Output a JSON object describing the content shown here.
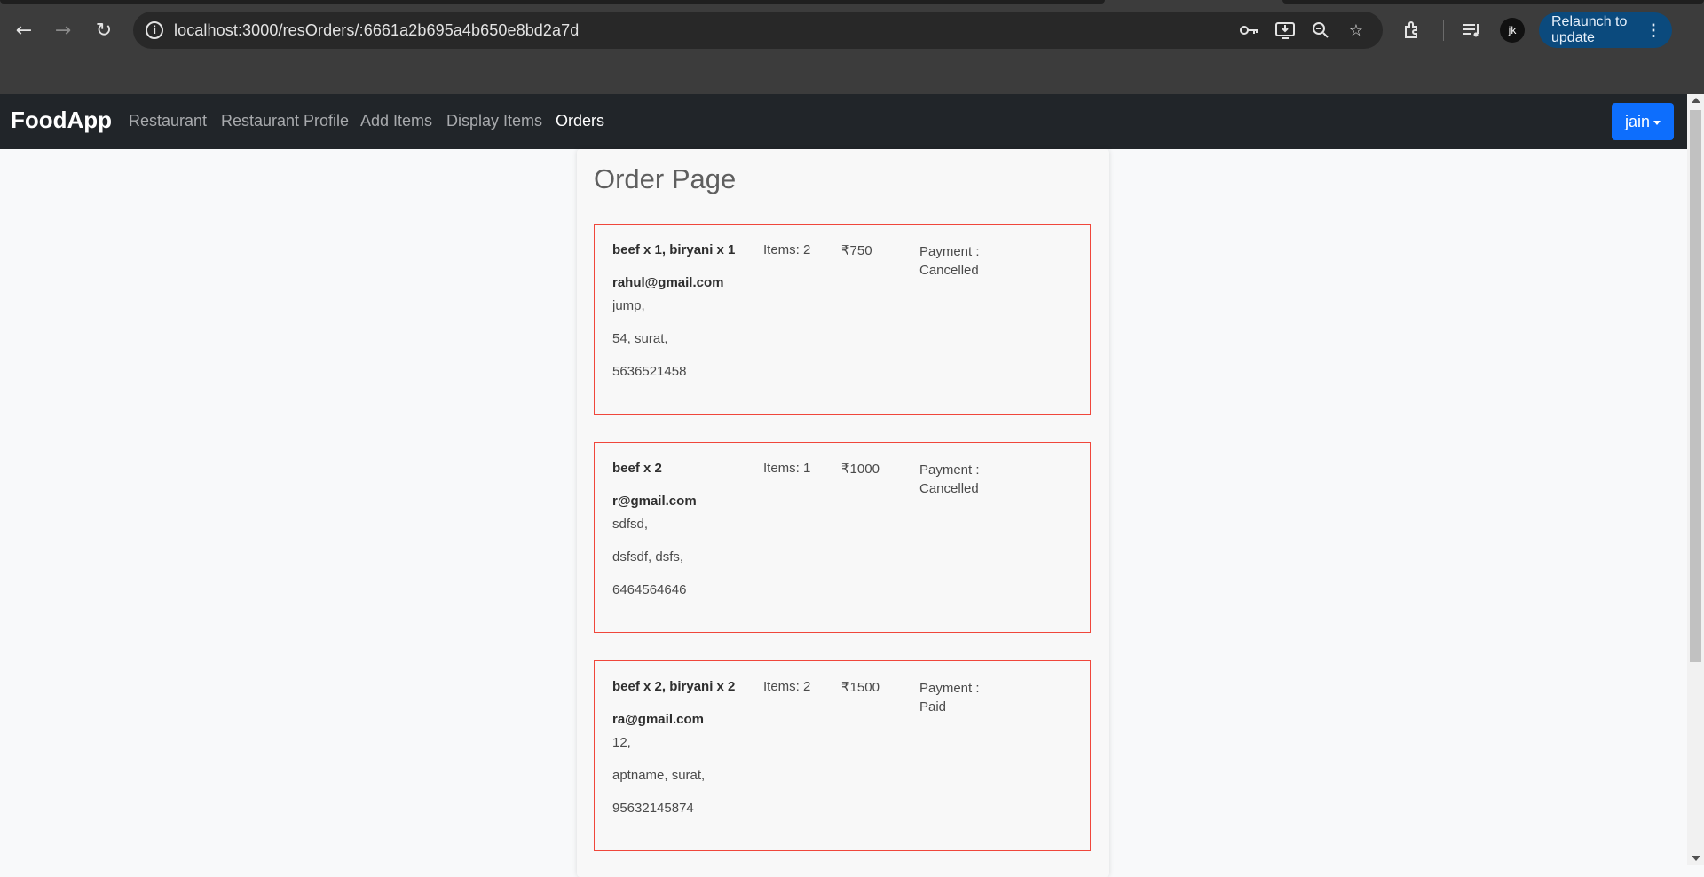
{
  "browser": {
    "url": "localhost:3000/resOrders/:6661a2b695a4b650e8bd2a7d",
    "relaunch_label": "Relaunch to update",
    "profile_initial": "jk",
    "icons": [
      "back-icon",
      "forward-icon",
      "reload-icon",
      "site-info-icon",
      "password-key-icon",
      "install-app-icon",
      "zoom-icon",
      "bookmark-star-icon",
      "extensions-icon",
      "reading-list-icon",
      "kebab-menu-icon"
    ]
  },
  "navbar": {
    "brand": "FoodApp",
    "links": [
      "Restaurant",
      "Restaurant Profile",
      "Add Items",
      "Display Items",
      "Orders"
    ],
    "active": "Orders",
    "user_button": "jain"
  },
  "page": {
    "title": "Order Page",
    "orders": [
      {
        "items": "beef x 1, biryani x 1",
        "count": "Items: 2",
        "price": "₹750",
        "payment_label": "Payment :",
        "payment_status": "Cancelled",
        "email": "rahul@gmail.com",
        "address1": "jump,",
        "address2": "54, surat,",
        "phone": "5636521458"
      },
      {
        "items": "beef x 2",
        "count": "Items: 1",
        "price": "₹1000",
        "payment_label": "Payment :",
        "payment_status": "Cancelled",
        "email": "r@gmail.com",
        "address1": "sdfsd,",
        "address2": "dsfsdf, dsfs,",
        "phone": "6464564646"
      },
      {
        "items": "beef x 2, biryani x 2",
        "count": "Items: 2",
        "price": "₹1500",
        "payment_label": "Payment :",
        "payment_status": "Paid",
        "email": "ra@gmail.com",
        "address1": "12,",
        "address2": "aptname, surat,",
        "phone": "95632145874"
      }
    ]
  },
  "colors": {
    "navbar_bg": "#212529",
    "primary": "#0d6efd",
    "card_border": "#f0473b"
  }
}
